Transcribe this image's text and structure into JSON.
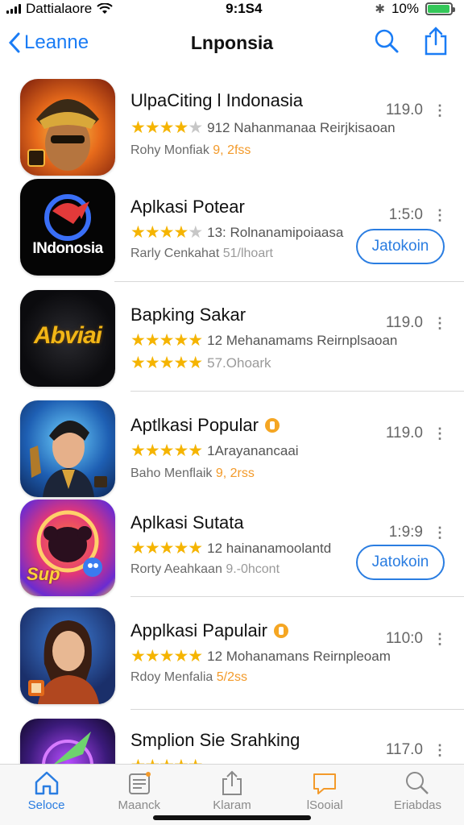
{
  "status_bar": {
    "carrier": "Dattialaore",
    "time": "9:1S4",
    "battery_percent": "10%",
    "battery_level": 0.95
  },
  "nav": {
    "back_label": "Leanne",
    "title": "Lnponsia",
    "search_icon": "search-icon",
    "share_icon": "share-icon"
  },
  "apps": [
    {
      "name": "UlpaCiting l Indonasia",
      "rating_text": "912 Nahanmanaa Reirjkisaoan",
      "stars": 4.5,
      "meta": "Rohy Monfiak",
      "meta_accent": "9, 2fss",
      "version": "119.0",
      "has_button": false
    },
    {
      "name": "Aplkasi Potear",
      "rating_text": "13: Rolnanamipoiaasa",
      "stars": 4.5,
      "meta": "Rarly Cenkahat",
      "meta_accent": "51/lhoart",
      "version": "1:5:0",
      "has_button": true,
      "button_label": "Jatokoin"
    },
    {
      "name": "Bapking Sakar",
      "rating_text": "12 Mehanamams Reirnplsaoan",
      "stars": 5,
      "meta": "",
      "second_stars": true,
      "meta_accent": "57.Ohoark",
      "version": "119.0",
      "has_button": false
    },
    {
      "name": "Aptlkasi Popular",
      "rating_text": "1Arayanancaai",
      "stars": 5,
      "meta": "Baho Menflaik",
      "meta_accent": "9, 2rss",
      "version": "119.0",
      "has_button": false,
      "badge": true
    },
    {
      "name": "Aplkasi Sutata",
      "rating_text": "12 hainanamoolantd",
      "stars": 5,
      "meta": "Rorty Aeahkaan",
      "meta_accent": "9.-0hcont",
      "version": "1:9:9",
      "has_button": true,
      "button_label": "Jatokoin"
    },
    {
      "name": "Applkasi Papulair",
      "rating_text": "12 Mohanamans Reirnpleoam",
      "stars": 5,
      "meta": "Rdoy Menfalia",
      "meta_accent": "5/2ss",
      "version": "110:0",
      "has_button": false,
      "badge": true
    },
    {
      "name": "Smplion Sie Srahking",
      "rating_text": "",
      "stars": 5,
      "meta": "",
      "meta_accent": "",
      "version": "117.0",
      "has_button": false
    }
  ],
  "icon_names": [
    "masked-hero-icon",
    "indonosia-logo-icon",
    "abviai-logo-icon",
    "anime-hero-icon",
    "monkey-character-icon",
    "woman-portrait-icon",
    "arrow-game-icon"
  ],
  "icon_overlay_text": {
    "indonesia": "INdonosia",
    "abviai": "Abviai",
    "sup": "Sup"
  },
  "tabs": [
    {
      "label": "Seloce",
      "icon": "home-icon",
      "active": true
    },
    {
      "label": "Maanck",
      "icon": "news-icon",
      "active": false
    },
    {
      "label": "Klaram",
      "icon": "share-icon",
      "active": false
    },
    {
      "label": "lSooial",
      "icon": "chat-icon",
      "active": false
    },
    {
      "label": "Eriabdas",
      "icon": "search-icon",
      "active": false
    }
  ],
  "colors": {
    "accent": "#1a7cf5",
    "star": "#f5b400",
    "orange": "#f39a2a",
    "battery": "#34c759"
  }
}
